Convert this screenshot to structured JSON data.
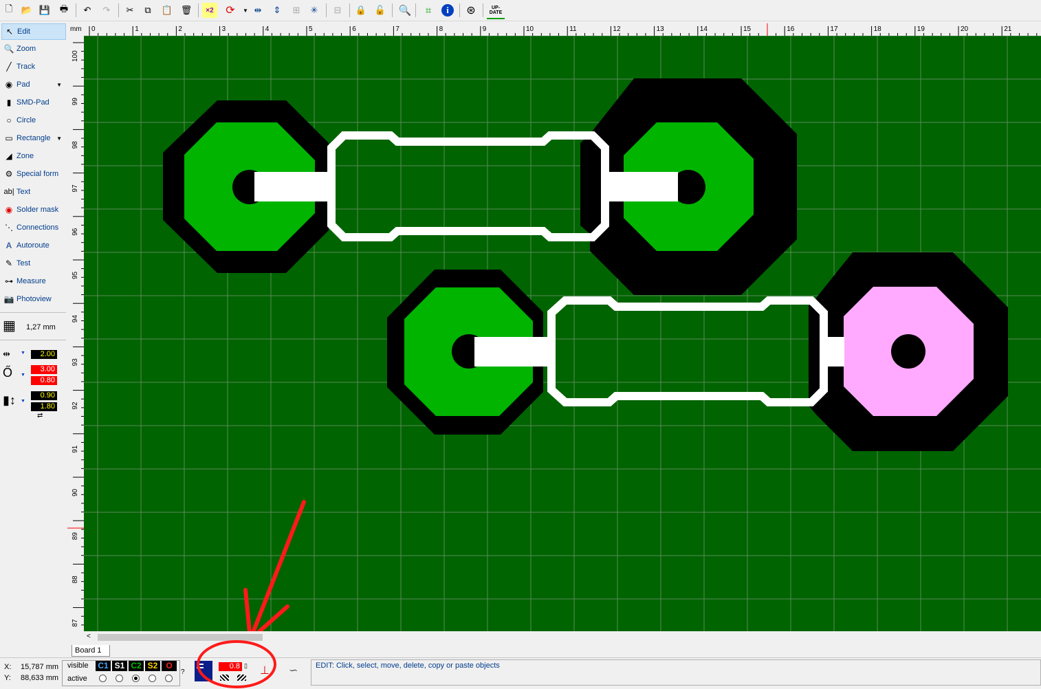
{
  "toolbar": {
    "buttons": [
      "new-file",
      "open-folder",
      "save",
      "print",
      "undo",
      "redo",
      "cut",
      "copy",
      "paste",
      "delete",
      "zoom-x2",
      "rotate",
      "mirror-horizontal",
      "mirror-vertical",
      "align",
      "spread",
      "group",
      "lock",
      "unlock",
      "zoom-fit",
      "crop",
      "info",
      "mesh",
      "update"
    ],
    "update_label": "UP-DATE"
  },
  "sidebar": {
    "items": [
      {
        "label": "Edit",
        "icon": "pointer-icon"
      },
      {
        "label": "Zoom",
        "icon": "zoom-icon"
      },
      {
        "label": "Track",
        "icon": "track-icon"
      },
      {
        "label": "Pad",
        "icon": "pad-icon"
      },
      {
        "label": "SMD-Pad",
        "icon": "smd-pad-icon"
      },
      {
        "label": "Circle",
        "icon": "circle-icon"
      },
      {
        "label": "Rectangle",
        "icon": "rectangle-icon"
      },
      {
        "label": "Zone",
        "icon": "zone-icon"
      },
      {
        "label": "Special form",
        "icon": "special-form-icon"
      },
      {
        "label": "Text",
        "icon": "text-icon"
      },
      {
        "label": "Solder mask",
        "icon": "solder-mask-icon"
      },
      {
        "label": "Connections",
        "icon": "connections-icon"
      },
      {
        "label": "Autoroute",
        "icon": "autoroute-icon"
      },
      {
        "label": "Test",
        "icon": "test-icon"
      },
      {
        "label": "Measure",
        "icon": "measure-icon"
      },
      {
        "label": "Photoview",
        "icon": "photoview-icon"
      }
    ],
    "grid_value": "1,27 mm",
    "track_width": "2.00",
    "pad_outer": "3.00",
    "pad_inner": "0.80",
    "smd_width": "0.90",
    "smd_height": "1.80"
  },
  "ruler": {
    "unit": "mm",
    "top_labels": [
      "0",
      "1",
      "2",
      "3",
      "4",
      "5",
      "6",
      "7",
      "8",
      "9",
      "10",
      "11",
      "12",
      "13",
      "14",
      "15",
      "16",
      "17",
      "18",
      "19",
      "20",
      "21"
    ],
    "left_labels": [
      "100",
      "99",
      "98",
      "97",
      "96",
      "95",
      "94",
      "93",
      "92",
      "91",
      "90",
      "89",
      "88",
      "87"
    ]
  },
  "tabs": {
    "board": "Board 1"
  },
  "status": {
    "x_label": "X:",
    "x_value": "15,787 mm",
    "y_label": "Y:",
    "y_value": "88,633 mm",
    "visible_label": "visible",
    "active_label": "active",
    "layers": [
      {
        "name": "C1",
        "color": "#4aa8ff"
      },
      {
        "name": "S1",
        "color": "#ffffff"
      },
      {
        "name": "C2",
        "color": "#00c000"
      },
      {
        "name": "S2",
        "color": "#ffd700"
      },
      {
        "name": "O",
        "color": "#ff2020"
      }
    ],
    "active_layer_index": 2,
    "question": "?",
    "ground_value": "0.8",
    "hint": "EDIT:  Click, select, move, delete, copy or paste objects"
  },
  "colors": {
    "board": "#006400",
    "copper_c2": "#00b400",
    "clearance": "#000000",
    "highlight_pad": "#ffaaff",
    "annotation": "#ff0000"
  }
}
